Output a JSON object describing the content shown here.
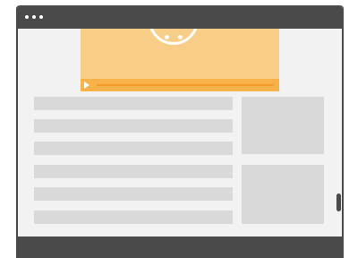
{
  "window": {
    "title": "",
    "controls": [
      "window-dot-icon",
      "window-dot-icon",
      "window-dot-icon"
    ]
  },
  "video": {
    "icon": "smiley-face-icon",
    "play_icon": "play-icon",
    "progress_percent": 0
  },
  "content": {
    "text_lines": 6,
    "side_panels": 2
  },
  "colors": {
    "frame": "#4a4a4a",
    "background": "#f2f2f2",
    "video_bg": "#f8cd87",
    "video_controls": "#f7b24a",
    "placeholder": "#d9d9d9"
  }
}
